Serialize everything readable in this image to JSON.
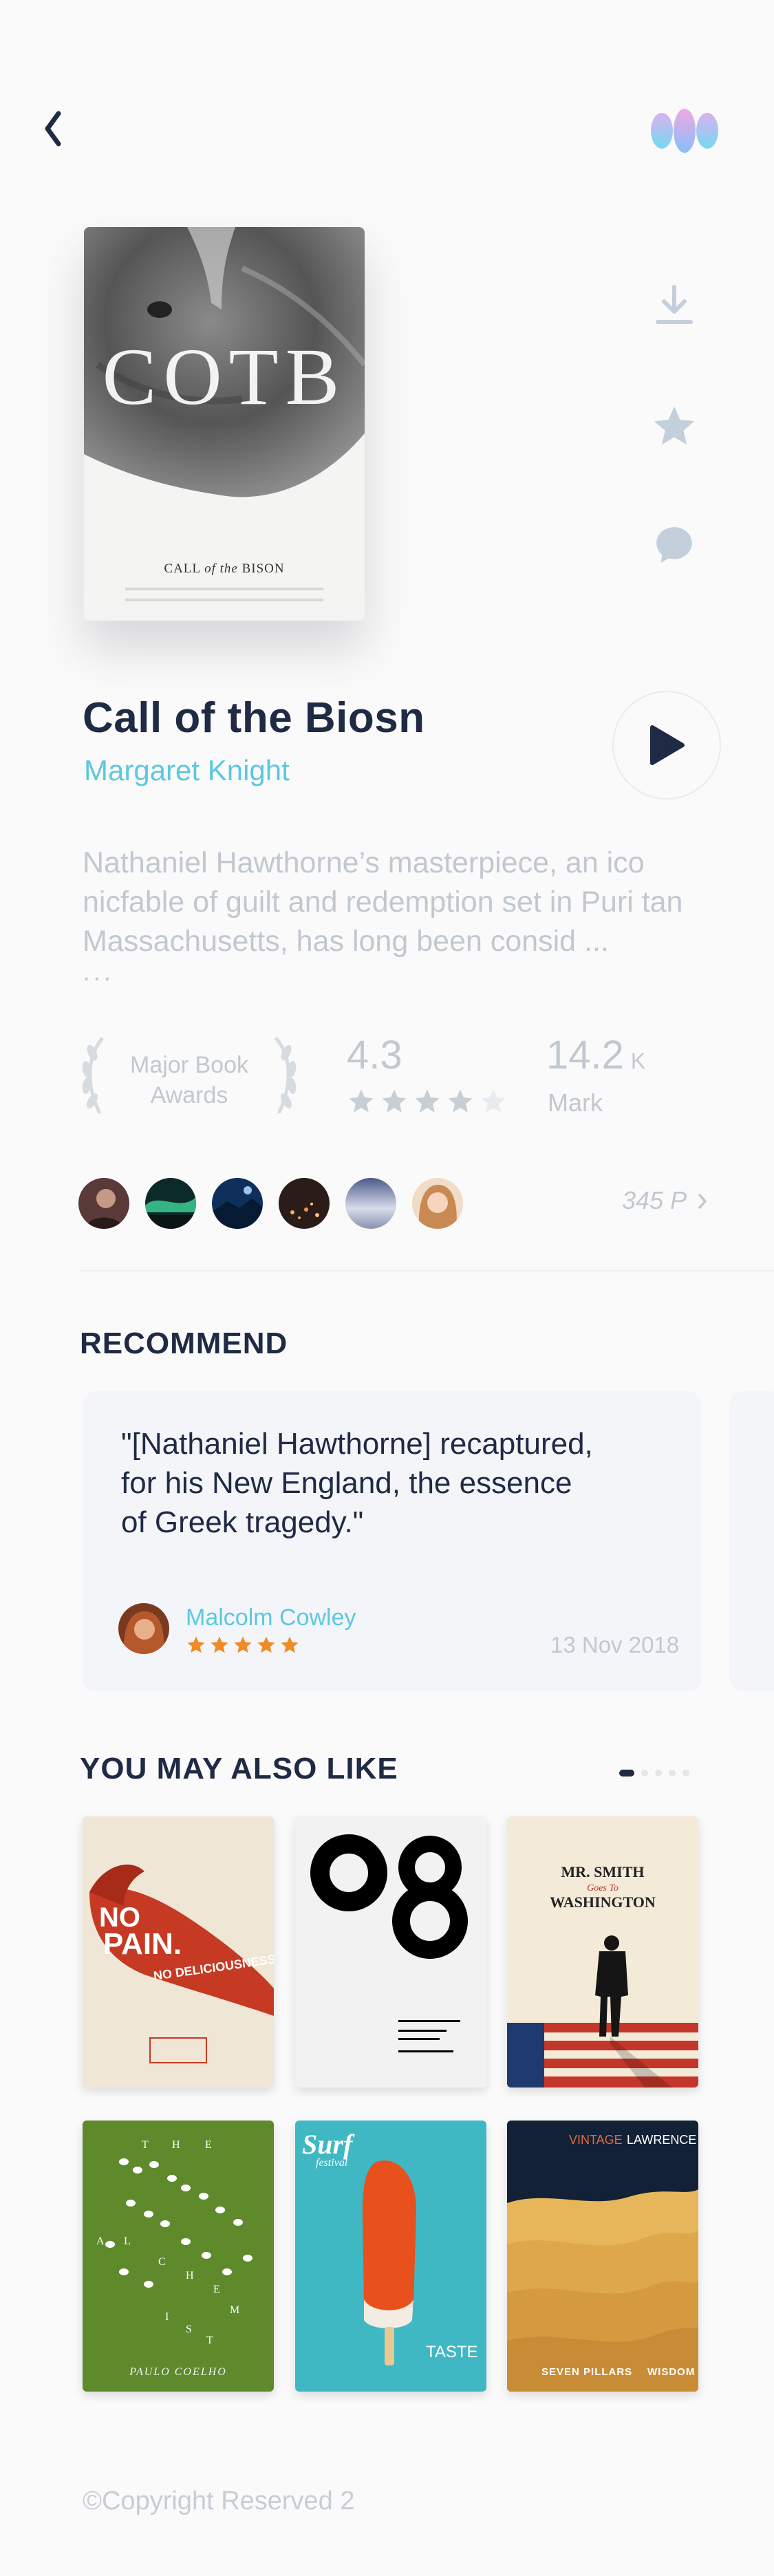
{
  "book": {
    "title": "Call of the Biosn",
    "author": "Margaret Knight",
    "cover_title": "COTB",
    "cover_subtitle_pre": "CALL",
    "cover_subtitle_of": "of the",
    "cover_subtitle_post": "BISON",
    "description": "Nathaniel Hawthorne’s masterpiece, an ico nicfable of guilt and redemption set in Puri tan Massachusetts, has long been consid ...",
    "more": "..."
  },
  "stats": {
    "award_line1": "Major Book",
    "award_line2": "Awards",
    "rating": "4.3",
    "rating_stars_filled": 4,
    "rating_stars_total": 5,
    "mark_value": "14.2",
    "mark_unit": "K",
    "mark_label": "Mark"
  },
  "readers": {
    "pages": "345 P"
  },
  "recommend": {
    "section_title": "RECOMMEND",
    "quote_line1": "\"[Nathaniel Hawthorne] recaptured,",
    "quote_line2": "for his New England, the essence",
    "quote_line3": "of Greek tragedy.\"",
    "reviewer": "Malcolm Cowley",
    "stars": 5,
    "date": "13 Nov 2018"
  },
  "also_like": {
    "section_title": "YOU MAY ALSO LIKE",
    "pages_total": 5,
    "page_active": 1,
    "books": [
      {
        "cover_text": "NO PAIN. NO DELICIOUSNESS"
      },
      {
        "cover_text": "08"
      },
      {
        "cover_text": "MR. SMITH Goes To WASHINGTON"
      },
      {
        "cover_text": "THE ALCHEMIST · PAULO COELHO"
      },
      {
        "cover_text": "Surf festival · TASTE"
      },
      {
        "cover_text": "VINTAGE LAWRENCE · SEVEN PILLARS WISDOM"
      }
    ]
  },
  "footer": {
    "copyright": "©Copyright Reserved 2"
  },
  "colors": {
    "accent": "#5cc8e0",
    "text_dark": "#1f2a44",
    "text_muted": "#c2c8d0",
    "star_orange": "#f08a24"
  }
}
